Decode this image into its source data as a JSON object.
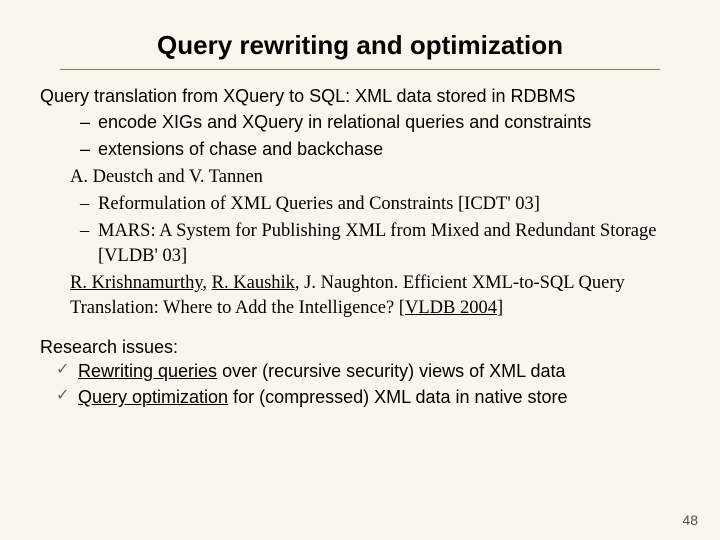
{
  "title": "Query rewriting and optimization",
  "lead": "Query translation from XQuery to SQL: XML data stored in RDBMS",
  "dash": {
    "d1": "encode XIGs and XQuery in relational queries and constraints",
    "d2": "extensions of chase and backchase"
  },
  "authors1": "A. Deustch and V. Tannen",
  "serif_dash": {
    "s1": "Reformulation of XML Queries and Constraints [ICDT' 03]",
    "s2": "MARS: A System for Publishing XML from Mixed and Redundant Storage  [VLDB' 03]"
  },
  "ref": {
    "a1": "R. Krishnamurthy",
    "sep1": ", ",
    "a2": "R. Kaushik",
    "rest1": ", J. Naughton. Efficient XML-to-SQL Query Translation: Where to Add the Intelligence? [",
    "link": "VLDB 2004",
    "rest2": "]"
  },
  "research_title": "Research issues:",
  "check": {
    "c1a": "Rewriting queries",
    "c1b": " over (recursive security) views of XML data",
    "c2a": "Query optimization",
    "c2b": " for (compressed) XML data in native store"
  },
  "page_num": "48"
}
